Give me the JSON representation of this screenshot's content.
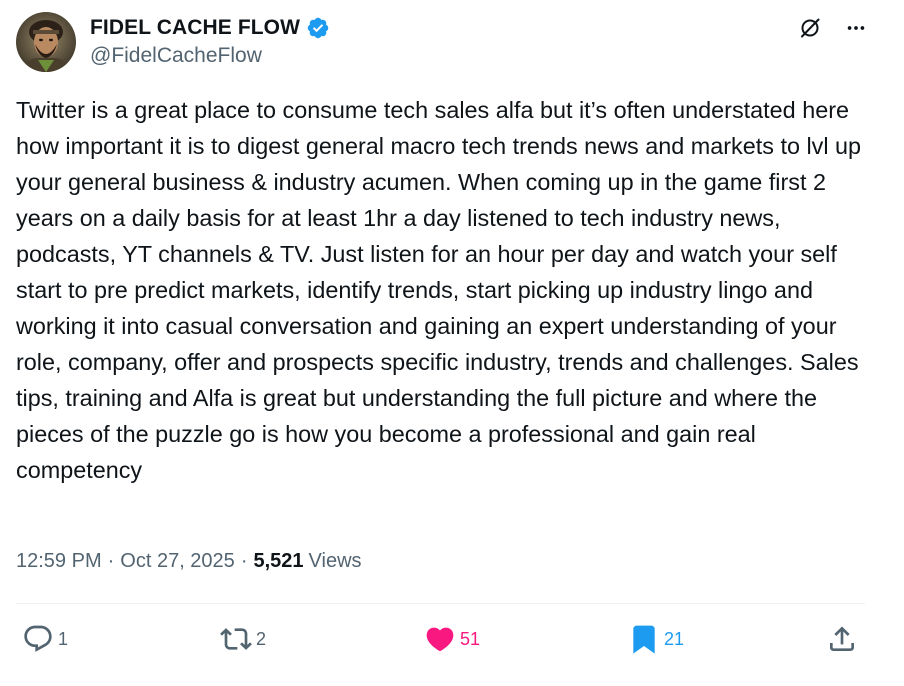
{
  "author": {
    "display_name": "FIDEL CACHE FLOW",
    "handle": "@FidelCacheFlow",
    "verified": true,
    "verified_color": "#1d9bf0"
  },
  "tweet": {
    "text": "Twitter is a great place to consume tech sales alfa but it’s often understated here how important it is to digest general macro tech trends news and markets to lvl up your general business & industry acumen. When coming up in the game first 2 years on a daily basis for at least 1hr a day listened to tech industry news, podcasts, YT channels & TV. Just listen for an hour per day and watch your self start to pre predict markets, identify trends, start picking up industry lingo and working it into casual conversation and gaining an expert understanding of your role, company, offer and prospects specific industry, trends and challenges. Sales tips, training and Alfa is great but understanding the full picture and where the pieces of the puzzle go is how you become a professional and gain real competency"
  },
  "meta": {
    "time": "12:59 PM",
    "separator": "·",
    "date": "Oct 27, 2025",
    "views_count": "5,521",
    "views_label": "Views"
  },
  "actions": {
    "replies": "1",
    "reposts": "2",
    "likes": "51",
    "bookmarks": "21"
  },
  "icons": {
    "top_right": [
      "grok-slash-icon",
      "more-icon"
    ],
    "action_bar": [
      "reply-icon",
      "retweet-icon",
      "heart-icon",
      "bookmark-icon",
      "share-icon"
    ]
  },
  "colors": {
    "text_primary": "#0f1419",
    "text_secondary": "#536471",
    "like_active": "#f91880",
    "bookmark_active": "#1d9bf0"
  }
}
